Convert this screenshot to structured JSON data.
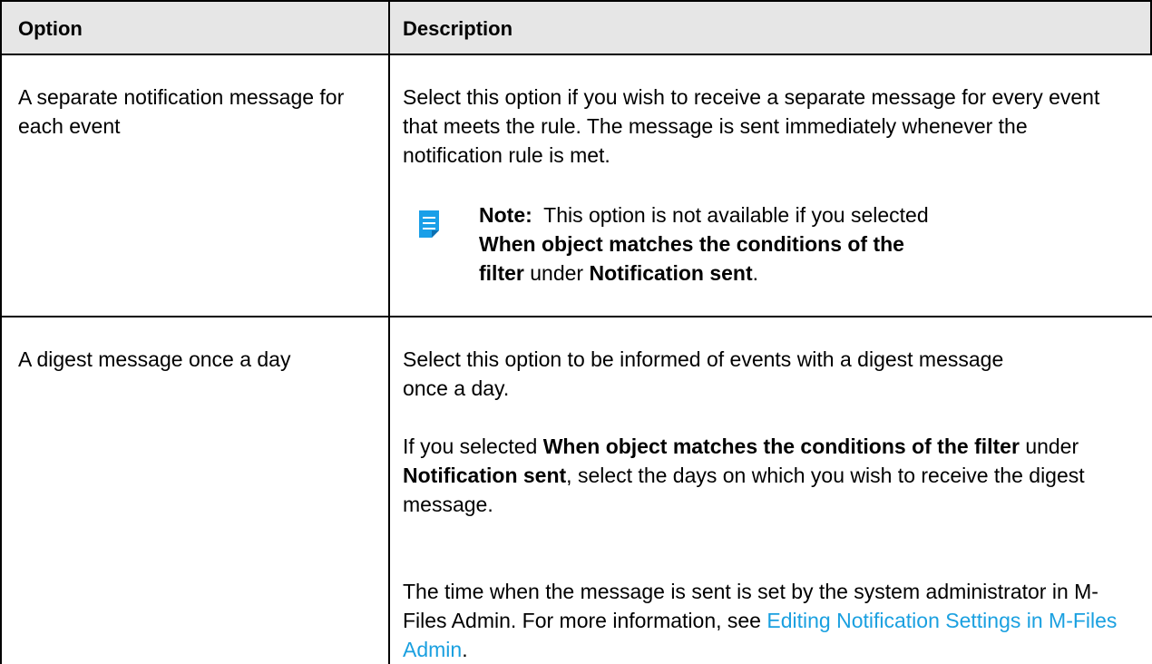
{
  "header": {
    "option": "Option",
    "description": "Description"
  },
  "rows": [
    {
      "option": "A separate notification message for each event",
      "description": "Select this option if you wish to receive a separate message for every event that meets the rule. The message is sent immediately whenever the notification rule is met.",
      "note": {
        "label": "Note:",
        "text_1": "This option is not available if you selected",
        "bold_1": "When object matches the conditions of the filter",
        "text_2": "under",
        "bold_2": "Notification sent",
        "text_3": "."
      }
    },
    {
      "option": "A digest message once a day",
      "para1": "Select this option to be informed of events with a digest message once a day.",
      "para2": {
        "text_1": "If you selected",
        "bold_1": "When object matches the conditions of the filter",
        "text_2": "under",
        "bold_2": "Notification sent",
        "text_3": ", select the days on which you wish to receive the digest message."
      },
      "para3": {
        "text_1": "The time when the message is sent is set by the system administrator in M-Files Admin. For more information, see",
        "link": "Editing Notification Settings in M-Files Admin",
        "text_2": "."
      }
    }
  ],
  "colors": {
    "header_bg": "#e6e6e6",
    "link": "#1aa0e0",
    "note_icon": "#1a9fe8"
  },
  "icons": {
    "note": "note-icon"
  }
}
